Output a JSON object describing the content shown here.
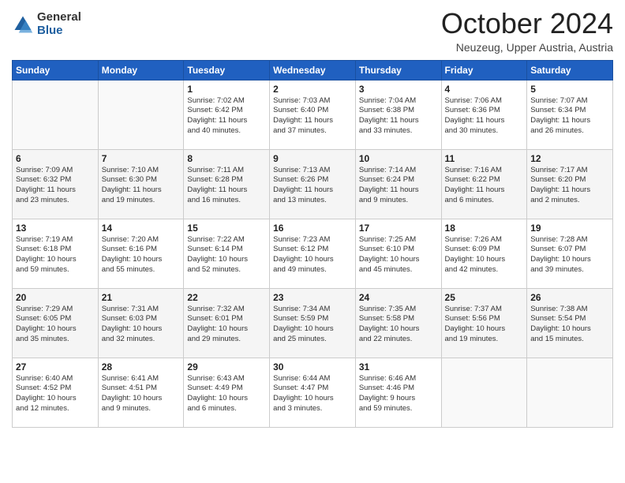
{
  "logo": {
    "general": "General",
    "blue": "Blue"
  },
  "header": {
    "month": "October 2024",
    "location": "Neuzeug, Upper Austria, Austria"
  },
  "weekdays": [
    "Sunday",
    "Monday",
    "Tuesday",
    "Wednesday",
    "Thursday",
    "Friday",
    "Saturday"
  ],
  "weeks": [
    [
      {
        "day": "",
        "info": ""
      },
      {
        "day": "",
        "info": ""
      },
      {
        "day": "1",
        "info": "Sunrise: 7:02 AM\nSunset: 6:42 PM\nDaylight: 11 hours\nand 40 minutes."
      },
      {
        "day": "2",
        "info": "Sunrise: 7:03 AM\nSunset: 6:40 PM\nDaylight: 11 hours\nand 37 minutes."
      },
      {
        "day": "3",
        "info": "Sunrise: 7:04 AM\nSunset: 6:38 PM\nDaylight: 11 hours\nand 33 minutes."
      },
      {
        "day": "4",
        "info": "Sunrise: 7:06 AM\nSunset: 6:36 PM\nDaylight: 11 hours\nand 30 minutes."
      },
      {
        "day": "5",
        "info": "Sunrise: 7:07 AM\nSunset: 6:34 PM\nDaylight: 11 hours\nand 26 minutes."
      }
    ],
    [
      {
        "day": "6",
        "info": "Sunrise: 7:09 AM\nSunset: 6:32 PM\nDaylight: 11 hours\nand 23 minutes."
      },
      {
        "day": "7",
        "info": "Sunrise: 7:10 AM\nSunset: 6:30 PM\nDaylight: 11 hours\nand 19 minutes."
      },
      {
        "day": "8",
        "info": "Sunrise: 7:11 AM\nSunset: 6:28 PM\nDaylight: 11 hours\nand 16 minutes."
      },
      {
        "day": "9",
        "info": "Sunrise: 7:13 AM\nSunset: 6:26 PM\nDaylight: 11 hours\nand 13 minutes."
      },
      {
        "day": "10",
        "info": "Sunrise: 7:14 AM\nSunset: 6:24 PM\nDaylight: 11 hours\nand 9 minutes."
      },
      {
        "day": "11",
        "info": "Sunrise: 7:16 AM\nSunset: 6:22 PM\nDaylight: 11 hours\nand 6 minutes."
      },
      {
        "day": "12",
        "info": "Sunrise: 7:17 AM\nSunset: 6:20 PM\nDaylight: 11 hours\nand 2 minutes."
      }
    ],
    [
      {
        "day": "13",
        "info": "Sunrise: 7:19 AM\nSunset: 6:18 PM\nDaylight: 10 hours\nand 59 minutes."
      },
      {
        "day": "14",
        "info": "Sunrise: 7:20 AM\nSunset: 6:16 PM\nDaylight: 10 hours\nand 55 minutes."
      },
      {
        "day": "15",
        "info": "Sunrise: 7:22 AM\nSunset: 6:14 PM\nDaylight: 10 hours\nand 52 minutes."
      },
      {
        "day": "16",
        "info": "Sunrise: 7:23 AM\nSunset: 6:12 PM\nDaylight: 10 hours\nand 49 minutes."
      },
      {
        "day": "17",
        "info": "Sunrise: 7:25 AM\nSunset: 6:10 PM\nDaylight: 10 hours\nand 45 minutes."
      },
      {
        "day": "18",
        "info": "Sunrise: 7:26 AM\nSunset: 6:09 PM\nDaylight: 10 hours\nand 42 minutes."
      },
      {
        "day": "19",
        "info": "Sunrise: 7:28 AM\nSunset: 6:07 PM\nDaylight: 10 hours\nand 39 minutes."
      }
    ],
    [
      {
        "day": "20",
        "info": "Sunrise: 7:29 AM\nSunset: 6:05 PM\nDaylight: 10 hours\nand 35 minutes."
      },
      {
        "day": "21",
        "info": "Sunrise: 7:31 AM\nSunset: 6:03 PM\nDaylight: 10 hours\nand 32 minutes."
      },
      {
        "day": "22",
        "info": "Sunrise: 7:32 AM\nSunset: 6:01 PM\nDaylight: 10 hours\nand 29 minutes."
      },
      {
        "day": "23",
        "info": "Sunrise: 7:34 AM\nSunset: 5:59 PM\nDaylight: 10 hours\nand 25 minutes."
      },
      {
        "day": "24",
        "info": "Sunrise: 7:35 AM\nSunset: 5:58 PM\nDaylight: 10 hours\nand 22 minutes."
      },
      {
        "day": "25",
        "info": "Sunrise: 7:37 AM\nSunset: 5:56 PM\nDaylight: 10 hours\nand 19 minutes."
      },
      {
        "day": "26",
        "info": "Sunrise: 7:38 AM\nSunset: 5:54 PM\nDaylight: 10 hours\nand 15 minutes."
      }
    ],
    [
      {
        "day": "27",
        "info": "Sunrise: 6:40 AM\nSunset: 4:52 PM\nDaylight: 10 hours\nand 12 minutes."
      },
      {
        "day": "28",
        "info": "Sunrise: 6:41 AM\nSunset: 4:51 PM\nDaylight: 10 hours\nand 9 minutes."
      },
      {
        "day": "29",
        "info": "Sunrise: 6:43 AM\nSunset: 4:49 PM\nDaylight: 10 hours\nand 6 minutes."
      },
      {
        "day": "30",
        "info": "Sunrise: 6:44 AM\nSunset: 4:47 PM\nDaylight: 10 hours\nand 3 minutes."
      },
      {
        "day": "31",
        "info": "Sunrise: 6:46 AM\nSunset: 4:46 PM\nDaylight: 9 hours\nand 59 minutes."
      },
      {
        "day": "",
        "info": ""
      },
      {
        "day": "",
        "info": ""
      }
    ]
  ]
}
